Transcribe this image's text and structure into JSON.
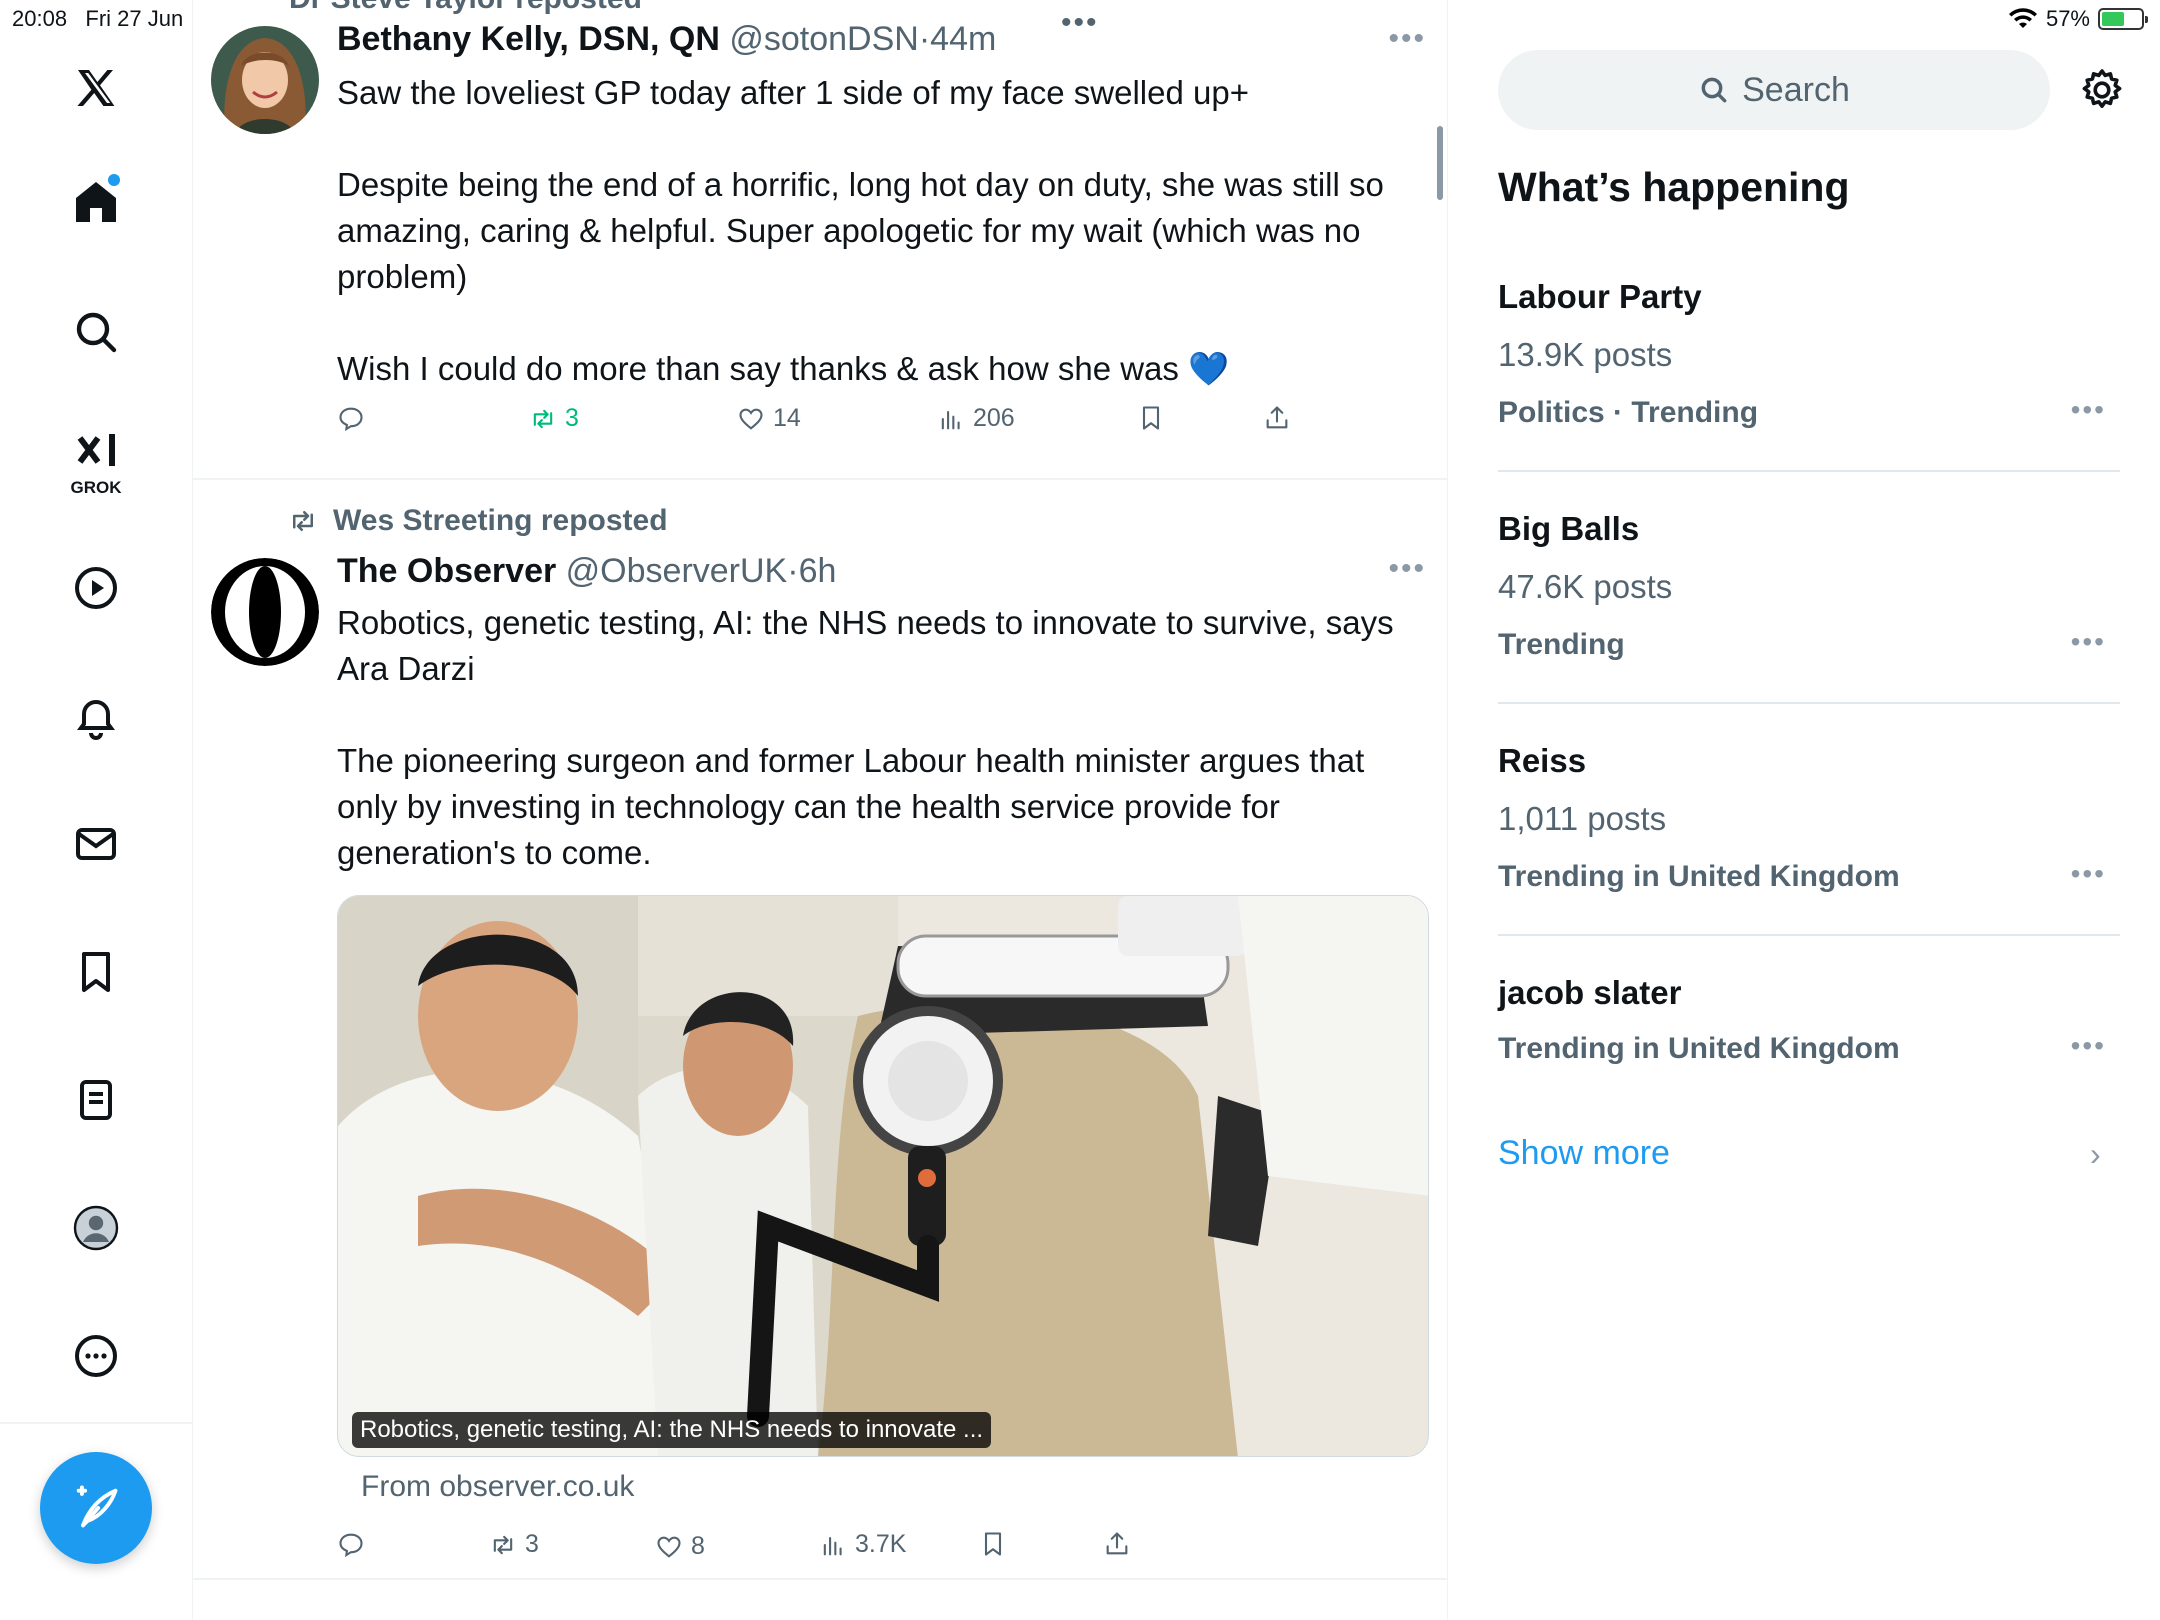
{
  "status_bar": {
    "time": "20:08",
    "date": "Fri 27 Jun",
    "battery": "57%",
    "battery_level": 0.57
  },
  "sidebar": {
    "items": [
      {
        "icon": "x-logo-icon"
      },
      {
        "icon": "home-icon"
      },
      {
        "icon": "search-icon"
      },
      {
        "icon": "grok-icon",
        "label": "GROK"
      },
      {
        "icon": "video-icon"
      },
      {
        "icon": "notifications-icon"
      },
      {
        "icon": "messages-icon"
      },
      {
        "icon": "bookmarks-icon"
      },
      {
        "icon": "lists-icon"
      },
      {
        "icon": "profile-icon"
      },
      {
        "icon": "more-icon"
      }
    ],
    "compose_icon": "compose-icon"
  },
  "feed": {
    "top_repost_partial": "Dr Steve Taylor reposted",
    "posts": [
      {
        "name": "Bethany Kelly, DSN, QN",
        "handle": "@sotonDSN",
        "time": "44m",
        "text": "Saw the loveliest GP today after 1 side of my face swelled up+\n\nDespite being the end of a horrific, long hot day on duty, she was still so amazing, caring & helpful. Super apologetic for my wait (which was no problem)\n\nWish I could do more than say thanks & ask how she was 💙",
        "reply_count": "",
        "repost_count": "3",
        "like_count": "14",
        "view_count": "206"
      },
      {
        "reposted_by": "Wes Streeting reposted",
        "name": "The Observer",
        "handle": "@ObserverUK",
        "time": "6h",
        "text": "Robotics, genetic testing, AI: the NHS needs to innovate to survive, says Ara Darzi\n\nThe pioneering surgeon and former Labour health minister argues that only by investing in technology can the health service provide for generation's to come.",
        "media_caption": "Robotics, genetic testing, AI: the NHS needs to innovate ...",
        "media_source": "From observer.co.uk",
        "reply_count": "",
        "repost_count": "3",
        "like_count": "8",
        "view_count": "3.7K"
      }
    ]
  },
  "right": {
    "search_placeholder": "Search",
    "whats_happening": "What’s happening",
    "trends": [
      {
        "name": "Labour Party",
        "count": "13.9K posts",
        "category": "Politics · Trending"
      },
      {
        "name": "Big Balls",
        "count": "47.6K posts",
        "category": "Trending"
      },
      {
        "name": "Reiss",
        "count": "1,011 posts",
        "category": "Trending in United Kingdom"
      },
      {
        "name": "jacob slater",
        "count": "",
        "category": "Trending in United Kingdom"
      }
    ],
    "show_more": "Show more"
  },
  "colors": {
    "accent": "#1d9bf0",
    "repost_green": "#00ba7c",
    "secondary_text": "#536471"
  }
}
